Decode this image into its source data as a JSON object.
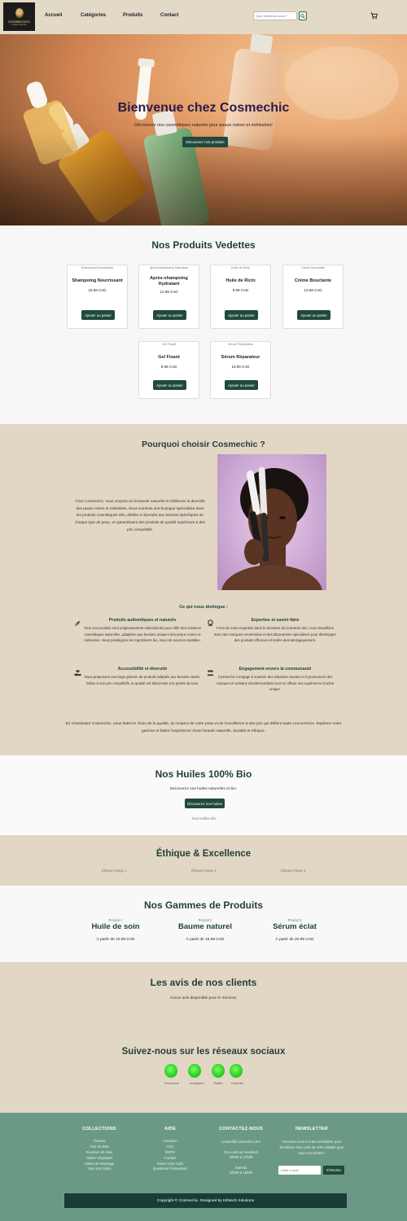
{
  "header": {
    "logo_name": "COSMECHIC",
    "logo_tag": "beauté naturelle",
    "nav": [
      "Accueil",
      "Catégories",
      "Produits",
      "Contact"
    ],
    "search_placeholder": "Que cherchez-vous ?"
  },
  "hero": {
    "title": "Bienvenue chez Cosmechic",
    "subtitle": "Découvrez nos cosmétiques naturels pour peaux noires et métissées!",
    "button": "Découvrez nos produits"
  },
  "featured": {
    "title": "Nos Produits Vedettes",
    "products": [
      {
        "alt": "Shampoing Nourrissant",
        "name": "Shampoing Nourrissant",
        "price": "15.99 CAD",
        "button": "Ajouter au panier"
      },
      {
        "alt": "Après-shampoing Hydratant",
        "name": "Après-shampoing Hydratant",
        "price": "12.99 CAD",
        "button": "Ajouter au panier"
      },
      {
        "alt": "Huile de Ricin",
        "name": "Huile de Ricin",
        "price": "9.99 CAD",
        "button": "Ajouter au panier"
      },
      {
        "alt": "Crème Bouclante",
        "name": "Crème Bouclante",
        "price": "13.99 CAD",
        "button": "Ajouter au panier"
      },
      {
        "alt": "Gel Fixant",
        "name": "Gel Fixant",
        "price": "8.99 CAD",
        "button": "Ajouter au panier"
      },
      {
        "alt": "Sérum Réparateur",
        "name": "Sérum Réparateur",
        "price": "19.99 CAD",
        "button": "Ajouter au panier"
      }
    ]
  },
  "why": {
    "title": "Pourquoi choisir Cosmechic ?",
    "text": "Chez Cosmechic, nous croyons en la beauté naturelle et célébrons la diversité des peaux noires et métissées. Nous sommes une boutique spécialisée dans les produits cosmétiques afro, dédiée à répondre aux besoins spécifiques de chaque type de peau, en garantissant des produits de qualité supérieure à des prix compétitifs.",
    "subtitle": "Ce qui nous distingue :",
    "features": [
      {
        "title": "Produits authentiques et naturels",
        "text": "Tous nos produits sont soigneusement sélectionnés pour offrir des solutions cosmétiques naturelles, adaptées aux besoins uniques des peaux noires et métissées. Nous privilégions les ingrédients bio, issus de sources durables.",
        "icon": "leaf-hand-icon"
      },
      {
        "title": "Expertise et savoir-faire",
        "text": "Forts de notre expertise dans le domaine de la beauté afro, nous travaillons avec des marques renommées et des laboratoires spécialisés pour développer des produits efficaces et testés dermatologiquement.",
        "icon": "award-icon"
      },
      {
        "title": "Accessibilité et diversité",
        "text": "Nous proposons une large gamme de produits adaptés aux besoins variés. Grâce à nos prix compétitifs, la qualité est désormais à la portée de tous.",
        "icon": "hand-heart-icon"
      },
      {
        "title": "Engagement envers la communauté",
        "text": "Cosmechic s'engage à soutenir des initiatives locales et à promouvoir des marques et artisans afrodescendants tout en offrant une expérience d'achat unique.",
        "icon": "community-icon"
      }
    ],
    "closing": "En choisissant Cosmechic, vous faites le choix de la qualité, du respect de votre peau et de l'excellence à des prix qui défient toute concurrence. Explorez notre gamme et faites l'expérience d'une beauté naturelle, durable et éthique."
  },
  "oils": {
    "title": "Nos Huiles 100% Bio",
    "subtitle": "Découvrez nos huiles naturelles et bio.",
    "button": "Découvrez nos huiles",
    "image_alt": "Nos Huiles Bio"
  },
  "ethic": {
    "title": "Éthique & Excellence",
    "images": [
      "Éthique Image 1",
      "Éthique Image 2",
      "Éthique Image 3"
    ]
  },
  "gammes": {
    "title": "Nos Gammes de Produits",
    "items": [
      {
        "alt": "Produit 1",
        "name": "Huile de soin",
        "price": "À partir de 10.99 CAD"
      },
      {
        "alt": "Produit 2",
        "name": "Baume naturel",
        "price": "À partir de 15.99 CAD"
      },
      {
        "alt": "Produit 3",
        "name": "Sérum éclat",
        "price": "À partir de 20.99 CAD"
      }
    ]
  },
  "avis": {
    "title": "Les avis de nos clients",
    "message": "Aucun avis disponible pour le moment."
  },
  "social": {
    "title": "Suivez-nous sur les réseaux sociaux",
    "links": [
      "Facebook",
      "Instagram",
      "Twitter",
      "LinkedIn"
    ]
  },
  "footer": {
    "collections": {
      "title": "COLLECTIONS",
      "items": [
        "Tisanes",
        "Avis de Bain",
        "Routines de Soin",
        "Huiles Végétales",
        "Huiles de Massage",
        "Tous nos Soins"
      ]
    },
    "aide": {
      "title": "AIDE",
      "items": [
        "Livraison",
        "CGV",
        "RGPD",
        "Contact",
        "Suivre mon Colis",
        "Questions Fréquentes"
      ]
    },
    "contact": {
      "title": "CONTACTEZ-NOUS",
      "email": "contact@cosmechic.com",
      "hours1": "Du Lundi au Vendredi",
      "hours1b": "10h00 à 17h00",
      "hours2": "Samedi",
      "hours2b": "10h00 à 15h00"
    },
    "newsletter": {
      "title": "NEWSLETTER",
      "text": "Inscrivez-vous à notre newsletter pour bénéficier d'un code de 10% valable pour tous vos achats !",
      "placeholder": "Votre e-mail",
      "button": "S'inscrire"
    },
    "copyright": "Copyright © Cosmechic. Designed by Infotech Solutions"
  },
  "colors": {
    "primary": "#1f4a3c",
    "beige": "#e2d7c4",
    "footer": "#6a9a86",
    "footer_bar": "#183d35"
  }
}
